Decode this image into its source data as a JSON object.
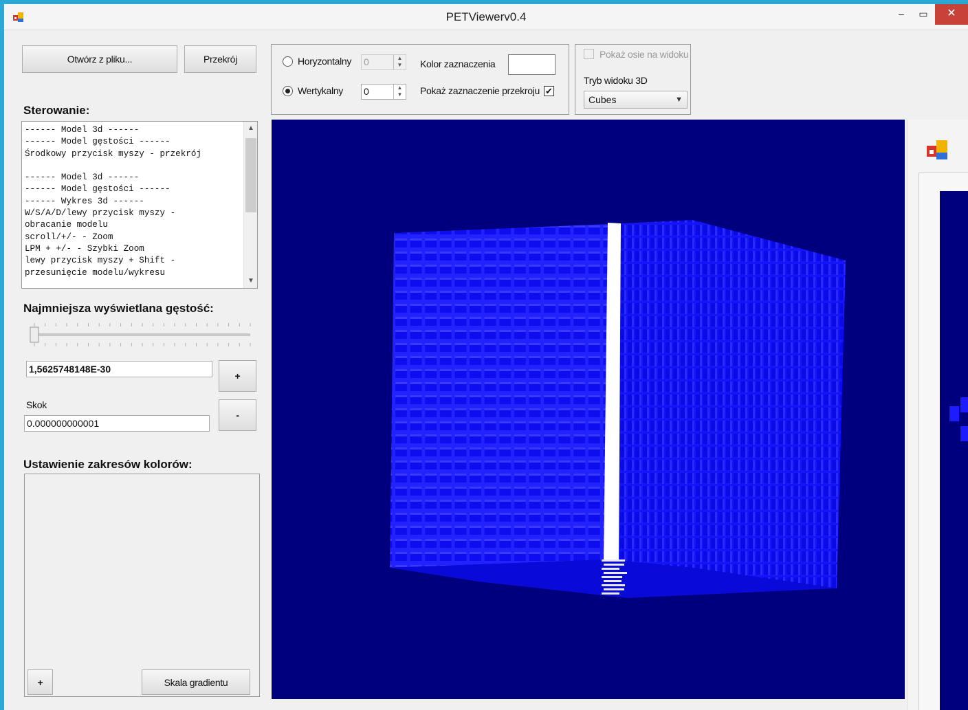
{
  "window": {
    "title": "PETViewerv0.4",
    "minimize": "–",
    "maximize": "▭",
    "close": "✕"
  },
  "toolbar": {
    "open_label": "Otwórz z pliku...",
    "section_label": "Przekrój"
  },
  "section_group": {
    "horizontal_label": "Horyzontalny",
    "horizontal_value": "0",
    "vertical_label": "Wertykalny",
    "vertical_value": "0",
    "orientation_selected": "Wertykalny",
    "highlight_color_label": "Kolor zaznaczenia",
    "highlight_color": "#ffffff",
    "show_section_label": "Pokaż zaznaczenie przekroju",
    "show_section_checked": true
  },
  "view_group": {
    "show_axes_label": "Pokaż osie na widoku",
    "show_axes_checked": false,
    "mode_label": "Tryb widoku 3D",
    "mode_value": "Cubes"
  },
  "controls": {
    "heading": "Sterowanie:",
    "text": "------ Model 3d ------\n------ Model gęstości ------\nŚrodkowy przycisk myszy - przekrój\n\n------ Model 3d ------\n------ Model gęstości ------\n------ Wykres 3d ------\nW/S/A/D/lewy przycisk myszy -\nobracanie modelu\nscroll/+/- - Zoom\nLPM + +/- - Szybki Zoom\nlewy przycisk myszy + Shift -\nprzesunięcie modelu/wykresu"
  },
  "density": {
    "heading": "Najmniejsza wyświetlana gęstość:",
    "slider_level": 0,
    "value": "1,5625748148E-30",
    "plus_label": "+",
    "step_label": "Skok",
    "step_value": "0.000000000001",
    "minus_label": "-"
  },
  "color_ranges": {
    "heading": "Ustawienie zakresów kolorów:",
    "add_label": "+",
    "gradient_label": "Skala gradientu"
  },
  "colors": {
    "viewport_bg": "#00007f",
    "cube_front": "#1a1aff",
    "cube_side": "#0f10f0",
    "section_slice": "#ffffff"
  }
}
